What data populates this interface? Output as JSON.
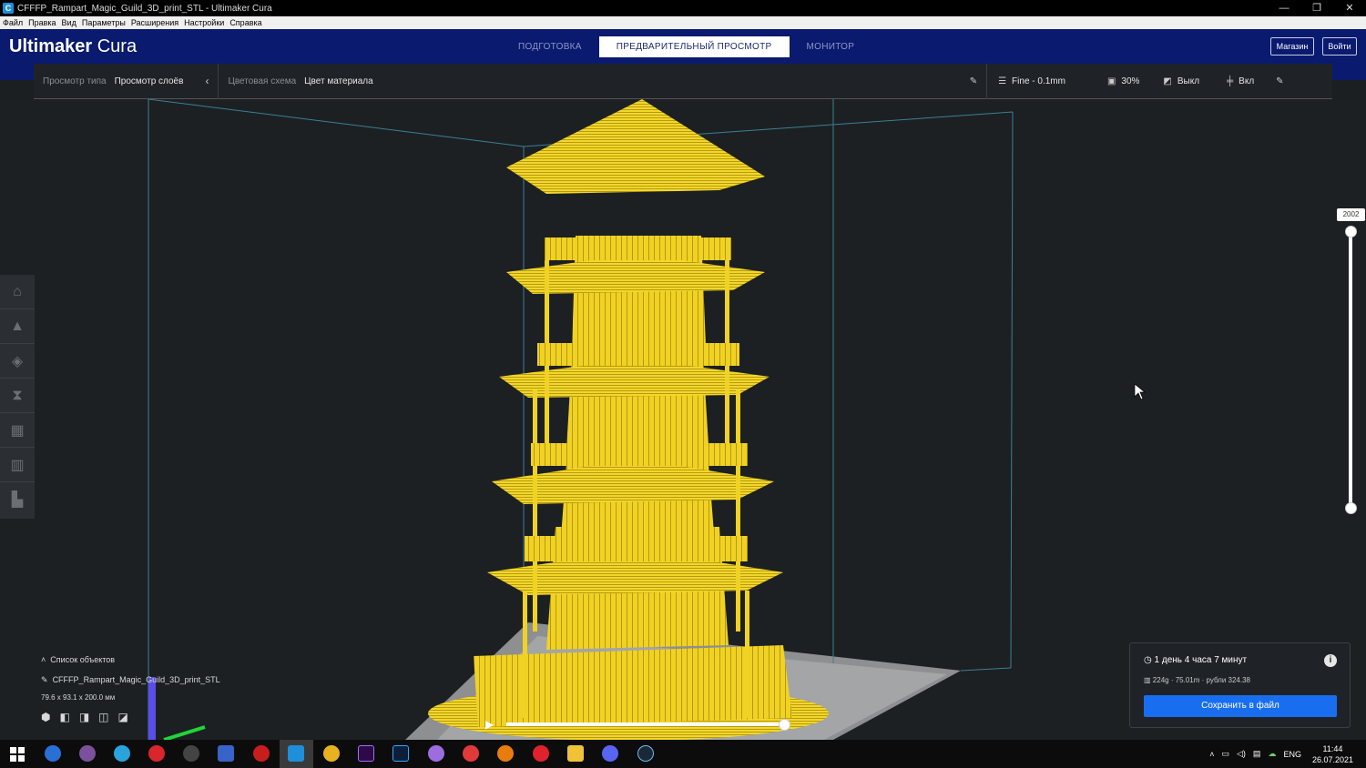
{
  "window": {
    "title": "CFFFP_Rampart_Magic_Guild_3D_print_STL - Ultimaker Cura",
    "minimize": "—",
    "maximize": "❐",
    "close": "✕"
  },
  "menu": [
    "Файл",
    "Правка",
    "Вид",
    "Параметры",
    "Расширения",
    "Настройки",
    "Справка"
  ],
  "header": {
    "logo_bold": "Ultimaker",
    "logo_light": " Cura",
    "stages": [
      {
        "label": "ПОДГОТОВКА",
        "active": false
      },
      {
        "label": "ПРЕДВАРИТЕЛЬНЫЙ ПРОСМОТР",
        "active": true
      },
      {
        "label": "МОНИТОР",
        "active": false
      }
    ],
    "store_button": "Магазин",
    "login_button": "Войти"
  },
  "toolbar": {
    "view_type_label": "Просмотр типа",
    "view_type_value": "Просмотр слоёв",
    "color_scheme_label": "Цветовая схема",
    "color_scheme_value": "Цвет материала",
    "profile": "Fine - 0.1mm",
    "infill": "30%",
    "support": "Выкл",
    "adhesion": "Вкл"
  },
  "layer_slider": {
    "current_layer": "2002"
  },
  "object_list": {
    "header": "Список объектов",
    "object_name": "CFFFP_Rampart_Magic_Guild_3D_print_STL",
    "dimensions": "79.6 x 93.1 x 200.0 мм"
  },
  "print_info": {
    "time": "1 день 4 часа 7 минут",
    "material": "224g · 75.01m · рубли 324.38",
    "save_button": "Сохранить в файл"
  },
  "colors": {
    "header": "#0a1a6f",
    "accent": "#196ef0",
    "model": "#f2d72a",
    "viewport": "#1c2023"
  },
  "taskbar": {
    "lang": "ENG",
    "time": "11:44",
    "date": "26.07.2021"
  }
}
